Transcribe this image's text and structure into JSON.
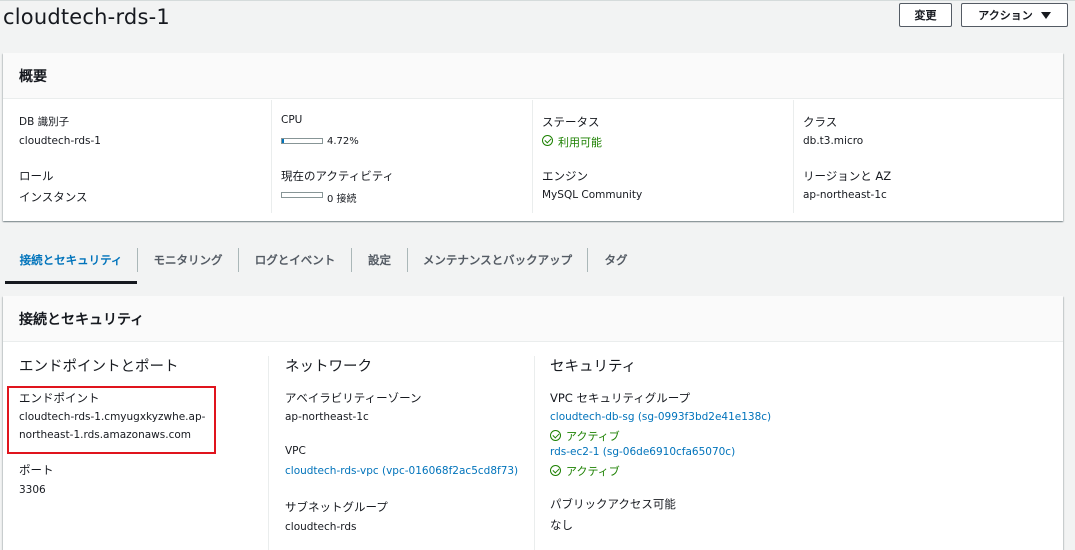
{
  "page": {
    "title": "cloudtech-rds-1"
  },
  "header": {
    "modify_label": "変更",
    "actions_label": "アクション"
  },
  "summary": {
    "heading": "概要",
    "db_id_label": "DB 識別子",
    "db_id_value": "cloudtech-rds-1",
    "role_label": "ロール",
    "role_value": "インスタンス",
    "cpu_label": "CPU",
    "cpu_value": "4.72%",
    "cpu_percent": 4.72,
    "activity_label": "現在のアクティビティ",
    "activity_value": "0 接続",
    "activity_percent": 0,
    "status_label": "ステータス",
    "status_value": "利用可能",
    "engine_label": "エンジン",
    "engine_value": "MySQL Community",
    "class_label": "クラス",
    "class_value": "db.t3.micro",
    "region_label": "リージョンと AZ",
    "region_value": "ap-northeast-1c"
  },
  "tabs": [
    {
      "label": "接続とセキュリティ",
      "active": true
    },
    {
      "label": "モニタリング",
      "active": false
    },
    {
      "label": "ログとイベント",
      "active": false
    },
    {
      "label": "設定",
      "active": false
    },
    {
      "label": "メンテナンスとバックアップ",
      "active": false
    },
    {
      "label": "タグ",
      "active": false
    }
  ],
  "connectivity": {
    "heading": "接続とセキュリティ",
    "endpoint_section": {
      "title": "エンドポイントとポート",
      "endpoint_label": "エンドポイント",
      "endpoint_line1": "cloudtech-rds-1.cmyugxkyzwhe.ap-",
      "endpoint_line2": "northeast-1.rds.amazonaws.com",
      "port_label": "ポート",
      "port_value": "3306"
    },
    "network_section": {
      "title": "ネットワーク",
      "az_label": "アベイラビリティーゾーン",
      "az_value": "ap-northeast-1c",
      "vpc_label": "VPC",
      "vpc_value": "cloudtech-rds-vpc (vpc-016068f2ac5cd8f73)",
      "subnet_label": "サブネットグループ",
      "subnet_value": "cloudtech-rds"
    },
    "security_section": {
      "title": "セキュリティ",
      "sg_label": "VPC セキュリティグループ",
      "sg1_value": "cloudtech-db-sg (sg-0993f3bd2e41e138c)",
      "sg1_status": "アクティブ",
      "sg2_value": "rds-ec2-1 (sg-06de6910cfa65070c)",
      "sg2_status": "アクティブ",
      "public_label": "パブリックアクセス可能",
      "public_value": "なし"
    }
  },
  "colors": {
    "link": "#0073bb",
    "success": "#1d8102",
    "highlight_box": "#e0141d"
  }
}
